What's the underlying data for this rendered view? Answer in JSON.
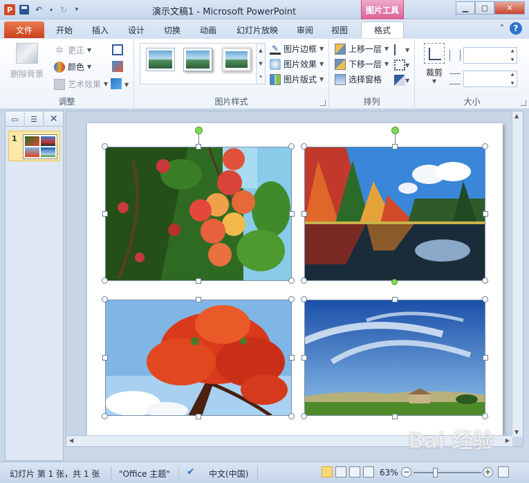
{
  "window": {
    "title": "演示文稿1 - Microsoft PowerPoint",
    "context_tab_group": "图片工具",
    "app_icon_letter": "P"
  },
  "tabs": [
    {
      "label": "文件"
    },
    {
      "label": "开始"
    },
    {
      "label": "插入"
    },
    {
      "label": "设计"
    },
    {
      "label": "切换"
    },
    {
      "label": "动画"
    },
    {
      "label": "幻灯片放映"
    },
    {
      "label": "审阅"
    },
    {
      "label": "视图"
    },
    {
      "label": "格式"
    }
  ],
  "help_label": "?",
  "ribbon": {
    "adjust": {
      "label": "调整",
      "remove_bg": "删除背景",
      "corrections": "更正",
      "color": "颜色",
      "artistic": "艺术效果"
    },
    "styles": {
      "label": "图片样式",
      "border": "图片边框",
      "effects": "图片效果",
      "layout": "图片版式"
    },
    "arrange": {
      "label": "排列",
      "bring_forward": "上移一层",
      "send_backward": "下移一层",
      "selection_pane": "选择窗格"
    },
    "size": {
      "label": "大小",
      "crop": "裁剪",
      "height_value": "",
      "width_value": ""
    }
  },
  "slides_pane": {
    "slide_number": "1"
  },
  "photos": [
    {
      "name": "plums",
      "colors": [
        "#2e6b1f",
        "#d94a3a",
        "#8fd0f0"
      ]
    },
    {
      "name": "autumn-lake",
      "colors": [
        "#c0392b",
        "#2a6fc2",
        "#1a2c3a"
      ]
    },
    {
      "name": "red-tree",
      "colors": [
        "#7fb6e6",
        "#e2401f",
        "#5a2a16"
      ]
    },
    {
      "name": "sky-field",
      "colors": [
        "#1f5fb3",
        "#a8cdee",
        "#5a8f2a"
      ]
    }
  ],
  "status": {
    "slide_info": "幻灯片 第 1 张，共 1 张",
    "theme": "\"Office 主题\"",
    "language": "中文(中国)",
    "zoom": "63%"
  },
  "watermark": "Bai 经验"
}
